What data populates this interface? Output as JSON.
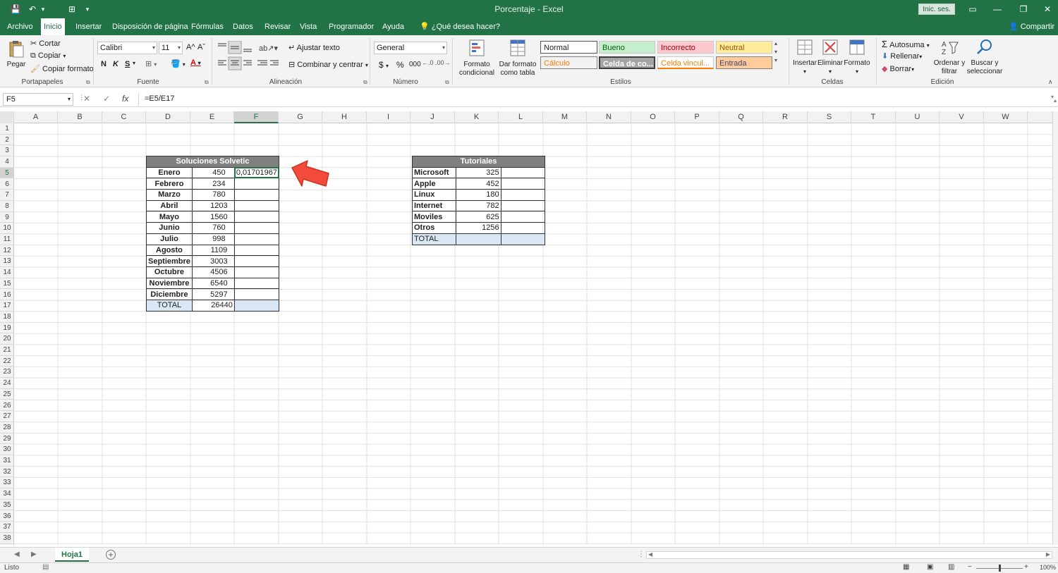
{
  "titlebar": {
    "title": "Porcentaje - Excel",
    "signin": "Inic. ses.",
    "qat_save": "💾",
    "qat_undo": "↶",
    "qat_touch": "⊞",
    "qat_more": "▾",
    "win_ribbon": "▭",
    "win_min": "—",
    "win_restore": "❐",
    "win_close": "✕"
  },
  "tabs": {
    "items": [
      "Archivo",
      "Inicio",
      "Insertar",
      "Disposición de página",
      "Fórmulas",
      "Datos",
      "Revisar",
      "Vista",
      "Programador",
      "Ayuda",
      "¿Qué desea hacer?"
    ],
    "share": "Compartir"
  },
  "ribbon": {
    "clipboard": {
      "paste": "Pegar",
      "cut": "Cortar",
      "copy": "Copiar",
      "format_painter": "Copiar formato",
      "label": "Portapapeles"
    },
    "font": {
      "name": "Calibri",
      "size": "11",
      "bold": "N",
      "italic": "K",
      "underline": "S",
      "label": "Fuente",
      "grow": "A^",
      "shrink": "Aˇ",
      "color_a": "A"
    },
    "alignment": {
      "wrap": "Ajustar texto",
      "merge": "Combinar y centrar",
      "label": "Alineación"
    },
    "number": {
      "format": "General",
      "currency": "$",
      "percent": "%",
      "thousands": "000",
      "label": "Número"
    },
    "styles": {
      "cond_format": "Formato condicional",
      "format_table": "Dar formato como tabla",
      "cells": [
        "Normal",
        "Bueno",
        "Incorrecto",
        "Neutral",
        "Cálculo",
        "Celda de co...",
        "Celda vincul...",
        "Entrada"
      ],
      "label": "Estilos"
    },
    "cells": {
      "insert": "Insertar",
      "delete": "Eliminar",
      "format": "Formato",
      "label": "Celdas"
    },
    "editing": {
      "autosum": "Autosuma",
      "fill": "Rellenar",
      "clear": "Borrar",
      "sort": "Ordenar y filtrar",
      "find": "Buscar y seleccionar",
      "label": "Edición"
    }
  },
  "formula_bar": {
    "name_box": "F5",
    "cancel": "✕",
    "enter": "✓",
    "fx": "fx",
    "formula": "=E5/E17"
  },
  "columns": [
    "A",
    "B",
    "C",
    "D",
    "E",
    "F",
    "G",
    "H",
    "I",
    "J",
    "K",
    "L",
    "M",
    "N",
    "O",
    "P",
    "Q",
    "R",
    "S",
    "T",
    "U",
    "V",
    "W"
  ],
  "rows": [
    "1",
    "2",
    "3",
    "4",
    "5",
    "6",
    "7",
    "8",
    "9",
    "10",
    "11",
    "12",
    "13",
    "14",
    "15",
    "16",
    "17",
    "18",
    "19",
    "20",
    "21",
    "22",
    "23",
    "24",
    "25",
    "26",
    "27",
    "28",
    "29",
    "30",
    "31",
    "32",
    "33",
    "34",
    "35",
    "36",
    "37",
    "38"
  ],
  "table1": {
    "title": "Soluciones Solvetic",
    "months": [
      "Enero",
      "Febrero",
      "Marzo",
      "Abril",
      "Mayo",
      "Junio",
      "Julio",
      "Agosto",
      "Septiembre",
      "Octubre",
      "Noviembre",
      "Diciembre"
    ],
    "values": [
      "450",
      "234",
      "780",
      "1203",
      "1560",
      "760",
      "998",
      "1109",
      "3003",
      "4506",
      "6540",
      "5297"
    ],
    "first_ratio": "0,01701967",
    "total_label": "TOTAL",
    "total_value": "26440"
  },
  "table2": {
    "title": "Tutoriales",
    "items": [
      "Microsoft",
      "Apple",
      "Linux",
      "Internet",
      "Moviles",
      "Otros"
    ],
    "values": [
      "325",
      "452",
      "180",
      "782",
      "625",
      "1256"
    ],
    "total_label": "TOTAL"
  },
  "sheetbar": {
    "sheet": "Hoja1",
    "add": "+",
    "prev": "◀",
    "next": "▶",
    "hprev": "◀",
    "hnext": "▶"
  },
  "status": {
    "ready": "Listo",
    "zoom": "100%"
  },
  "colors": {
    "excel_green": "#217346",
    "header_gray": "#808080",
    "total_blue": "#d9e7f5",
    "arrow_red": "#f24a3c"
  }
}
